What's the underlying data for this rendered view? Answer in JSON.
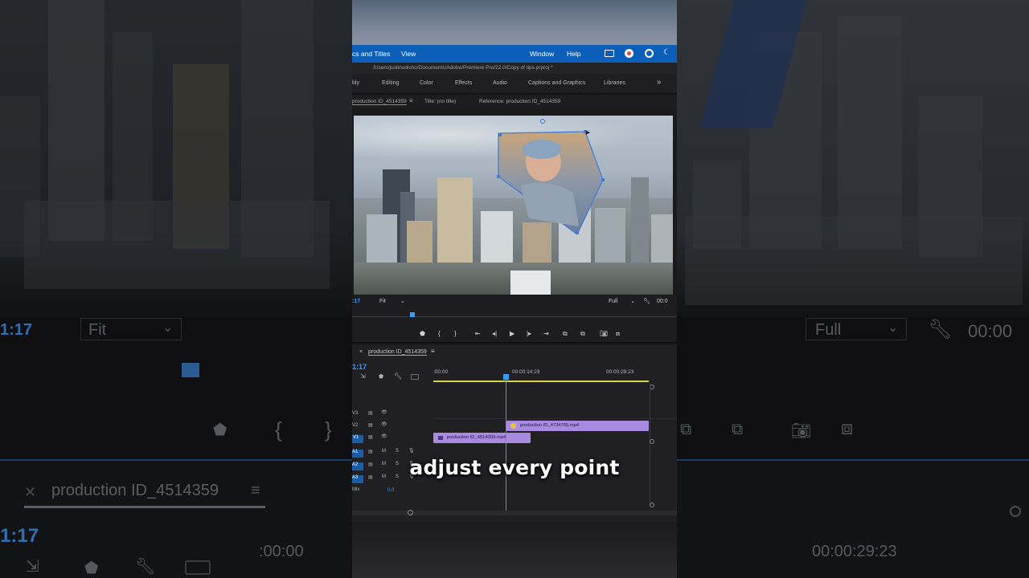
{
  "background": {
    "left_timecode": "1:17",
    "left_fit": "Fit",
    "left_sequence": "production ID_4514359",
    "left_timecode_2": "1:17",
    "left_ruler": ":00:00",
    "right_full": "Full",
    "right_timecode": "00:00",
    "right_ruler": "00:00:29:23"
  },
  "menubar": {
    "items": [
      "cs and Titles",
      "View",
      "Window",
      "Help"
    ],
    "color": "#0c5fb8"
  },
  "path": "/Users/justinodisho/Documents/Adobe/Premiere Pro/22.0/Copy of tips.prproj *",
  "workspaces": [
    "bly",
    "Editing",
    "Color",
    "Effects",
    "Audio",
    "Captions and Graphics",
    "Libraries",
    "»"
  ],
  "monitor": {
    "sequence_tab": "production ID_4514359",
    "title": "Title: (no title)",
    "reference": "Reference: production ID_4514359",
    "timecode": ":17",
    "fit": "Fit",
    "quality": "Full",
    "timecode_right": "00:0"
  },
  "timeline": {
    "sequence_tab": "production ID_4514359",
    "timecode": "1:17",
    "ruler": [
      ":00:00",
      "00:00:14:23",
      "00:00:29:23"
    ],
    "tracks": {
      "video": [
        "V3",
        "V2",
        "V1"
      ],
      "audio": [
        "A1",
        "A2",
        "A3"
      ],
      "mix": "Mix",
      "mix_value": "0.0"
    },
    "clips": {
      "v2": "production ID_4734765.mp4",
      "v1": "production ID_4514359.mp4"
    },
    "clip_color": "#a88ae0",
    "playhead_color": "#3a9cf5"
  },
  "caption": "adjust every point"
}
